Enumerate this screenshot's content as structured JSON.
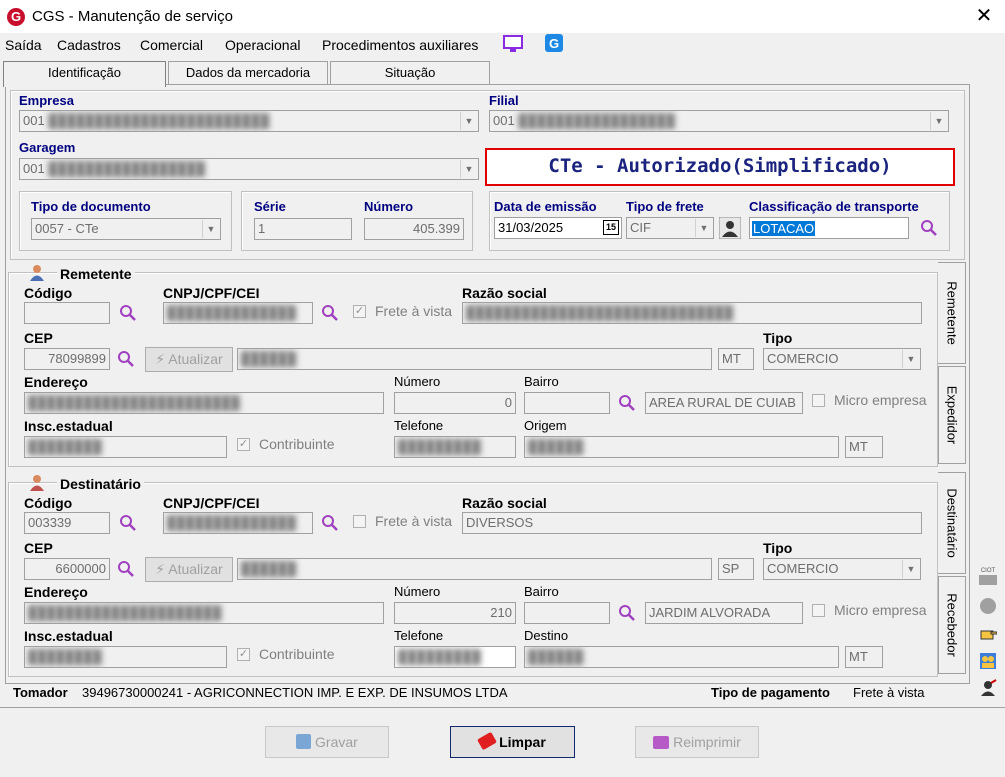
{
  "window": {
    "title": "CGS - Manutenção de serviço",
    "close": "✕",
    "logo": "G"
  },
  "menu": [
    "Saída",
    "Cadastros",
    "Comercial",
    "Operacional",
    "Procedimentos auxiliares"
  ],
  "tabs": [
    "Identificação",
    "Dados da mercadoria",
    "Situação"
  ],
  "status_banner": "CTe - Autorizado(Simplificado)",
  "empresa": {
    "label": "Empresa",
    "value": "001"
  },
  "filial": {
    "label": "Filial",
    "value": "001"
  },
  "garagem": {
    "label": "Garagem",
    "value": "001"
  },
  "tipo_documento": {
    "label": "Tipo de documento",
    "value": "0057 - CTe"
  },
  "serie": {
    "label": "Série",
    "value": "1"
  },
  "numero": {
    "label": "Número",
    "value": "405.399"
  },
  "data_emissao": {
    "label": "Data de emissão",
    "value": "31/03/2025",
    "calendar": "15"
  },
  "tipo_frete": {
    "label": "Tipo de frete",
    "value": "CIF"
  },
  "classificacao": {
    "label": "Classificação de transporte",
    "value": "LOTACAO"
  },
  "remetente": {
    "title": "Remetente",
    "codigo_label": "Código",
    "codigo": "",
    "cnpj_label": "CNPJ/CPF/CEI",
    "frete_vista": "Frete à vista",
    "razao_label": "Razão social",
    "cep_label": "CEP",
    "cep": "78099899",
    "atualizar": "Atualizar",
    "uf": "MT",
    "tipo_label": "Tipo",
    "tipo": "COMERCIO",
    "endereco_label": "Endereço",
    "numero_label": "Número",
    "numero": "0",
    "bairro_label": "Bairro",
    "bairro_nome": "AREA RURAL DE CUIAB",
    "micro_empresa": "Micro empresa",
    "insc_label": "Insc.estadual",
    "contribuinte": "Contribuinte",
    "telefone_label": "Telefone",
    "origem_label": "Origem",
    "origem_uf": "MT"
  },
  "destinatario": {
    "title": "Destinatário",
    "codigo_label": "Código",
    "codigo": "003339",
    "cnpj_label": "CNPJ/CPF/CEI",
    "frete_vista": "Frete à vista",
    "razao_label": "Razão social",
    "razao": "DIVERSOS",
    "cep_label": "CEP",
    "cep": "6600000",
    "atualizar": "Atualizar",
    "uf": "SP",
    "tipo_label": "Tipo",
    "tipo": "COMERCIO",
    "endereco_label": "Endereço",
    "numero_label": "Número",
    "numero": "210",
    "bairro_label": "Bairro",
    "bairro_nome": "JARDIM ALVORADA",
    "micro_empresa": "Micro empresa",
    "insc_label": "Insc.estadual",
    "contribuinte": "Contribuinte",
    "telefone_label": "Telefone",
    "destino_label": "Destino",
    "destino_uf": "MT"
  },
  "side_tabs": [
    "Remetente",
    "Expedidor",
    "Destinatário",
    "Recebedor"
  ],
  "side_icons": {
    "ciot": "CIOT"
  },
  "tomador": {
    "label": "Tomador",
    "value": "39496730000241 - AGRICONNECTION IMP. E EXP. DE INSUMOS LTDA"
  },
  "tipo_pagamento": {
    "label": "Tipo de pagamento",
    "value": "Frete à vista"
  },
  "buttons": {
    "gravar": "Gravar",
    "limpar": "Limpar",
    "reimprimir": "Reimprimir"
  },
  "colors": {
    "accent_blue": "#000080",
    "status_red": "#e00000",
    "magnifier": "#a040c0"
  }
}
